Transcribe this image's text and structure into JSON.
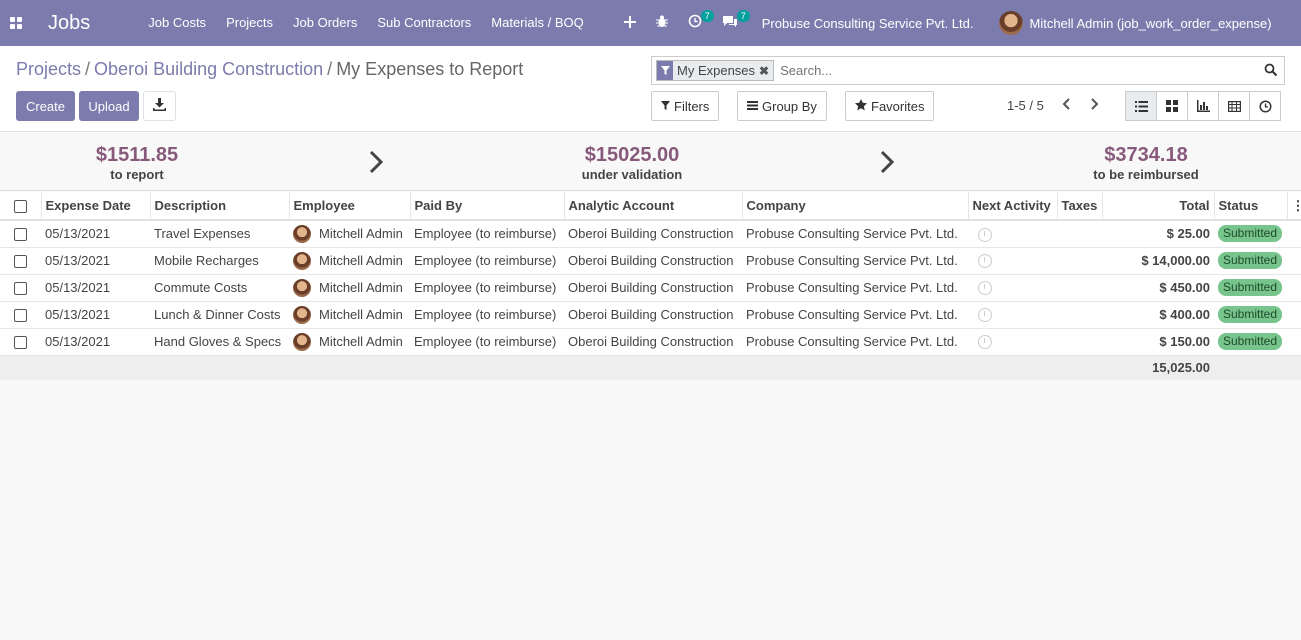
{
  "navbar": {
    "brand": "Jobs",
    "menu": [
      "Job Costs",
      "Projects",
      "Job Orders",
      "Sub Contractors",
      "Materials / BOQ"
    ],
    "activity_count": "7",
    "message_count": "7",
    "company": "Probuse Consulting Service Pvt. Ltd.",
    "user": "Mitchell Admin (job_work_order_expense)"
  },
  "breadcrumb": {
    "items": [
      "Projects",
      "Oberoi Building Construction"
    ],
    "current": "My Expenses to Report"
  },
  "buttons": {
    "create": "Create",
    "upload": "Upload"
  },
  "search": {
    "facet": "My Expenses",
    "placeholder": "Search..."
  },
  "controls": {
    "filters": "Filters",
    "group_by": "Group By",
    "favorites": "Favorites",
    "pager": "1-5 / 5"
  },
  "stages": [
    {
      "amount": "$1511.85",
      "label": "to report"
    },
    {
      "amount": "$15025.00",
      "label": "under validation"
    },
    {
      "amount": "$3734.18",
      "label": "to be reimbursed"
    }
  ],
  "table": {
    "columns": [
      "Expense Date",
      "Description",
      "Employee",
      "Paid By",
      "Analytic Account",
      "Company",
      "Next Activity",
      "Taxes",
      "Total",
      "Status"
    ],
    "rows": [
      {
        "date": "05/13/2021",
        "description": "Travel Expenses",
        "employee": "Mitchell Admin",
        "paid_by": "Employee (to reimburse)",
        "account": "Oberoi Building Construction",
        "company": "Probuse Consulting Service Pvt. Ltd.",
        "taxes": "",
        "total": "$ 25.00",
        "status": "Submitted"
      },
      {
        "date": "05/13/2021",
        "description": "Mobile Recharges",
        "employee": "Mitchell Admin",
        "paid_by": "Employee (to reimburse)",
        "account": "Oberoi Building Construction",
        "company": "Probuse Consulting Service Pvt. Ltd.",
        "taxes": "",
        "total": "$ 14,000.00",
        "status": "Submitted"
      },
      {
        "date": "05/13/2021",
        "description": "Commute Costs",
        "employee": "Mitchell Admin",
        "paid_by": "Employee (to reimburse)",
        "account": "Oberoi Building Construction",
        "company": "Probuse Consulting Service Pvt. Ltd.",
        "taxes": "",
        "total": "$ 450.00",
        "status": "Submitted"
      },
      {
        "date": "05/13/2021",
        "description": "Lunch & Dinner Costs",
        "employee": "Mitchell Admin",
        "paid_by": "Employee (to reimburse)",
        "account": "Oberoi Building Construction",
        "company": "Probuse Consulting Service Pvt. Ltd.",
        "taxes": "",
        "total": "$ 400.00",
        "status": "Submitted"
      },
      {
        "date": "05/13/2021",
        "description": "Hand Gloves & Specs",
        "employee": "Mitchell Admin",
        "paid_by": "Employee (to reimburse)",
        "account": "Oberoi Building Construction",
        "company": "Probuse Consulting Service Pvt. Ltd.",
        "taxes": "",
        "total": "$ 150.00",
        "status": "Submitted"
      }
    ],
    "footer_total": "15,025.00"
  },
  "colors": {
    "navbar": "#7c7bad",
    "stage_amount": "#875a7b",
    "status_badge": "#77c48c"
  }
}
